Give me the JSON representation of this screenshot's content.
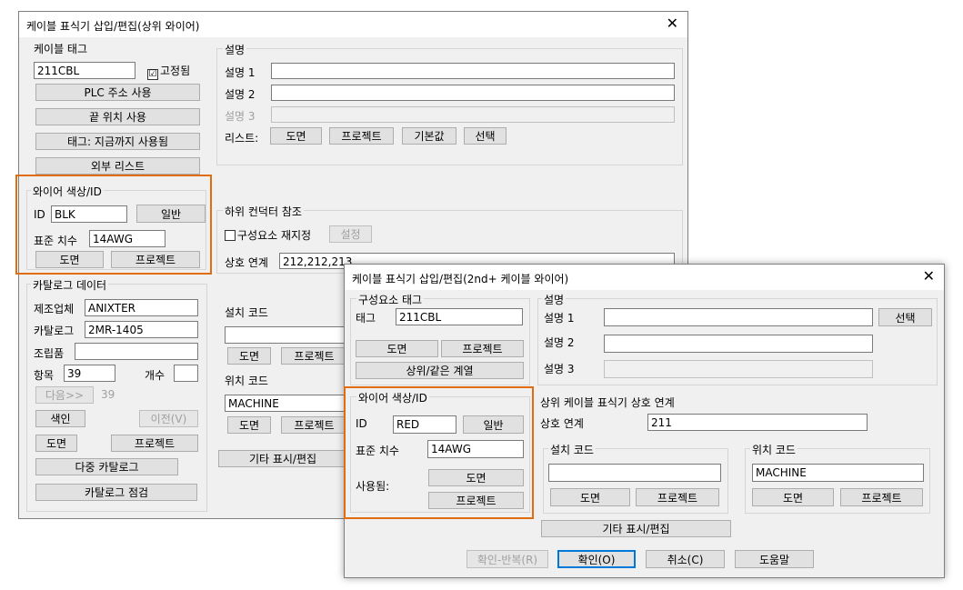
{
  "dlg1": {
    "title": "케이블 표식기 삽입/편집(상위 와이어)",
    "close": "✕",
    "cable_tag": {
      "label": "케이블 태그",
      "value": "211CBL",
      "fixed": "고정됨",
      "fixed_check": "☑",
      "plc": "PLC 주소 사용",
      "end": "끝 위치 사용",
      "tag_use": "태그: 지금까지 사용됨",
      "ext_list": "외부 리스트"
    },
    "wire": {
      "label": "와이어 색상/ID",
      "id_label": "ID",
      "id_value": "BLK",
      "normal": "일반",
      "size_label": "표준 치수",
      "size_value": "14AWG",
      "drawing": "도면",
      "project": "프로젝트"
    },
    "catalog": {
      "label": "카탈로그 데이터",
      "mfr_label": "제조업체",
      "mfr_value": "ANIXTER",
      "cat_label": "카탈로그",
      "cat_value": "2MR-1405",
      "assembly_label": "조립품",
      "assembly_value": "",
      "item_label": "항목",
      "item_value": "39",
      "count_label": "개수",
      "count_value": "",
      "next": "다음>>",
      "next_value": "39",
      "lookup": "색인",
      "prev": "이전(V)",
      "drawing": "도면",
      "project": "프로젝트",
      "multi": "다중 카탈로그",
      "check": "카탈로그 점검"
    },
    "desc": {
      "label": "설명",
      "d1": "설명 1",
      "d2": "설명 2",
      "d3": "설명 3",
      "v1": "",
      "v2": "",
      "v3": "",
      "list_label": "리스트:",
      "drawing": "도면",
      "project": "프로젝트",
      "default": "기본값",
      "pick": "선택"
    },
    "conductor": {
      "label": "하위 컨덕터 참조",
      "reassign": "구성요소 재지정",
      "setup": "설정",
      "cross_label": "상호 연계",
      "cross_value": "212,212,213"
    },
    "install": {
      "label": "설치 코드",
      "value": "",
      "drawing": "도면",
      "project": "프로젝트"
    },
    "location": {
      "label": "위치 코드",
      "value": "MACHINE",
      "drawing": "도면",
      "project": "프로젝트"
    },
    "other": "기타 표시/편집"
  },
  "dlg2": {
    "title": "케이블 표식기 삽입/편집(2nd+ 케이블 와이어)",
    "close": "✕",
    "comp_tag": {
      "label": "구성요소 태그",
      "tag_label": "태그",
      "tag_value": "211CBL",
      "drawing": "도면",
      "project": "프로젝트",
      "sibling": "상위/같은 계열"
    },
    "desc": {
      "label": "설명",
      "d1": "설명 1",
      "d2": "설명 2",
      "d3": "설명 3",
      "v1": "",
      "v2": "",
      "v3": "",
      "pick": "선택"
    },
    "wire": {
      "label": "와이어 색상/ID",
      "id_label": "ID",
      "id_value": "RED",
      "normal": "일반",
      "size_label": "표준 치수",
      "size_value": "14AWG",
      "used_label": "사용됨:",
      "drawing": "도면",
      "project": "프로젝트"
    },
    "cross": {
      "label": "상위 케이블 표식기 상호 연계",
      "cross_label": "상호 연계",
      "cross_value": "211"
    },
    "install": {
      "label": "설치 코드",
      "value": "",
      "drawing": "도면",
      "project": "프로젝트"
    },
    "location": {
      "label": "위치 코드",
      "value": "MACHINE",
      "drawing": "도면",
      "project": "프로젝트"
    },
    "other": "기타 표시/편집",
    "footer": {
      "ok_repeat": "확인-반복(R)",
      "ok": "확인(O)",
      "cancel": "취소(C)",
      "help": "도움말"
    }
  },
  "colors": {
    "highlight": "#e06d10",
    "dialog_bg": "#f0f0f0",
    "focus": "#0078d7"
  }
}
